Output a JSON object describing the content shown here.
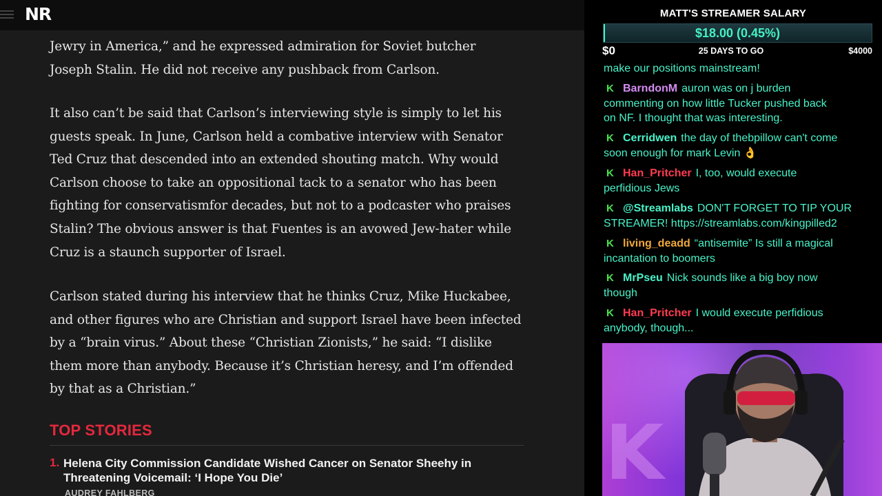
{
  "site": {
    "logo": "NR"
  },
  "article": {
    "paragraphs": [
      {
        "lines": [
          "Jewry in America,” and he expressed admiration for Soviet butcher",
          "Joseph Stalin. He did not receive any pushback from Carlson."
        ]
      },
      {
        "lines": [
          "It also can’t be said that Carlson’s interviewing style is simply to let his",
          "guests speak. In June, Carlson held a combative interview with Senator",
          "Ted Cruz that descended into an extended shouting match. Why would",
          "Carlson choose to take an oppositional tack to a senator who has been",
          "fighting for conservatismfor decades, but not to a podcaster who praises",
          "Stalin? The obvious answer is that Fuentes is an avowed Jew-hater while",
          "Cruz is a staunch supporter of Israel."
        ]
      },
      {
        "lines": [
          "Carlson stated during his interview that he thinks Cruz, Mike Huckabee,",
          "and other figures who are Christian and support Israel have been infected",
          "by a “brain virus.” About these “Christian Zionists,” he said: “I dislike",
          "them more than anybody. Because it’s Christian heresy, and I’m offended",
          "by that as a Christian.”"
        ]
      }
    ],
    "top_stories": {
      "heading": "TOP STORIES",
      "items": [
        {
          "number": "1.",
          "title_lines": [
            "Helena City Commission Candidate Wished Cancer on Senator Sheehy in",
            "Threatening Voicemail: ‘I Hope You Die’"
          ],
          "author": "AUDREY FAHLBERG"
        }
      ]
    }
  },
  "stream": {
    "salary": {
      "title": "MATT'S STREAMER SALARY",
      "amount": "$18.00 (0.45%)",
      "progress_fraction": 0.0045,
      "min": "$0",
      "countdown": "25 DAYS TO GO",
      "max": "$4000"
    },
    "chat": {
      "badge": "K",
      "messages": [
        {
          "user": "",
          "user_color": "#49f2c8",
          "lines": [
            "make our positions mainstream!"
          ]
        },
        {
          "user": "BarndonM",
          "user_color": "#d58cf2",
          "lines": [
            "auron was on j burden",
            "commenting on how little Tucker pushed back",
            "on NF. I thought that was interesting."
          ]
        },
        {
          "user": "Cerridwen",
          "user_color": "#49f2c8",
          "lines": [
            "the day of thebpillow can't come",
            "soon enough for mark Levin 👌"
          ]
        },
        {
          "user": "Han_Pritcher",
          "user_color": "#ff3b50",
          "lines": [
            "I, too, would execute",
            "perfidious Jews"
          ]
        },
        {
          "user": "@Streamlabs",
          "user_color": "#49f2c8",
          "lines": [
            "DON'T FORGET TO TIP YOUR",
            "STREAMER! https://streamlabs.com/kingpilled2"
          ]
        },
        {
          "user": "living_deadd",
          "user_color": "#f0a93a",
          "lines": [
            "“antisemite” Is still a magical",
            "incantation to boomers"
          ]
        },
        {
          "user": "MrPseu",
          "user_color": "#49f2c8",
          "lines": [
            "Nick sounds like a big boy now",
            "though"
          ]
        },
        {
          "user": "Han_Pritcher",
          "user_color": "#ff3b50",
          "lines": [
            "I would execute perfidious",
            "anybody, though..."
          ]
        }
      ]
    },
    "webcam": {
      "wall_letter": "K"
    }
  },
  "colors": {
    "accent_red": "#e4283d",
    "chat_teal": "#49f2c8",
    "badge_green": "#47e64a"
  }
}
